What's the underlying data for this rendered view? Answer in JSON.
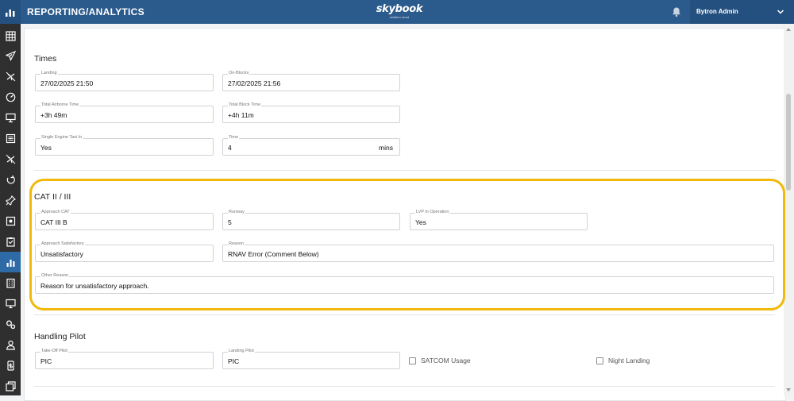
{
  "header": {
    "app_title": "REPORTING/ANALYTICS",
    "logo_text": "skybook",
    "logo_subtext": "aviation cloud",
    "user_name": "Bytron Admin"
  },
  "sidebar": {
    "items": [
      {
        "icon": "grid-icon",
        "active": false
      },
      {
        "icon": "plane-icon",
        "active": false
      },
      {
        "icon": "plane-crossed-icon",
        "active": false
      },
      {
        "icon": "gauge-icon",
        "active": false
      },
      {
        "icon": "presentation-icon",
        "active": false
      },
      {
        "icon": "document-list-icon",
        "active": false
      },
      {
        "icon": "plane-crossed-icon",
        "active": false
      },
      {
        "icon": "recycle-icon",
        "active": false
      },
      {
        "icon": "pin-icon",
        "active": false
      },
      {
        "icon": "square-target-icon",
        "active": false
      },
      {
        "icon": "clipboard-icon",
        "active": false
      },
      {
        "icon": "bar-chart-icon",
        "active": true
      },
      {
        "icon": "building-icon",
        "active": false
      },
      {
        "icon": "monitor-icon",
        "active": false
      },
      {
        "icon": "gears-icon",
        "active": false
      },
      {
        "icon": "user-icon",
        "active": false
      },
      {
        "icon": "phone-dollar-icon",
        "active": false
      },
      {
        "icon": "windows-icon",
        "active": false
      }
    ]
  },
  "times": {
    "title": "Times",
    "landing": {
      "label": "Landing",
      "value": "27/02/2025 21:50"
    },
    "on_blocks": {
      "label": "On-Blocks",
      "value": "27/02/2025 21:56"
    },
    "total_airborne": {
      "label": "Total Airborne Time",
      "value": "+3h 49m"
    },
    "total_block": {
      "label": "Total Block Time",
      "value": "+4h 11m"
    },
    "single_engine_taxi": {
      "label": "Single Engine Taxi In",
      "value": "Yes"
    },
    "time": {
      "label": "Time",
      "value": "4",
      "unit": "mins"
    }
  },
  "cat": {
    "title": "CAT II / III",
    "approach_cat": {
      "label": "Approach CAT",
      "value": "CAT III B"
    },
    "runway": {
      "label": "Runway",
      "value": "5"
    },
    "lvp": {
      "label": "LVP in Operation",
      "value": "Yes"
    },
    "approach_satisfactory": {
      "label": "Approach Satisfactory",
      "value": "Unsatisfactory"
    },
    "reason": {
      "label": "Reason",
      "value": "RNAV Error (Comment Below)"
    },
    "other_reason": {
      "label": "Other Reason",
      "value": "Reason for unsatisfactory approach."
    }
  },
  "handling": {
    "title": "Handling Pilot",
    "takeoff_pilot": {
      "label": "Take-Off Pilot",
      "value": "PIC"
    },
    "landing_pilot": {
      "label": "Landing Pilot",
      "value": "PIC"
    },
    "satcom_label": "SATCOM Usage",
    "night_landing_label": "Night Landing"
  },
  "colors": {
    "header_blue": "#2b5a8c",
    "sidebar_dark": "#2f2f2f",
    "active_nav": "#2e6aa6",
    "highlight": "#f0b90b"
  }
}
